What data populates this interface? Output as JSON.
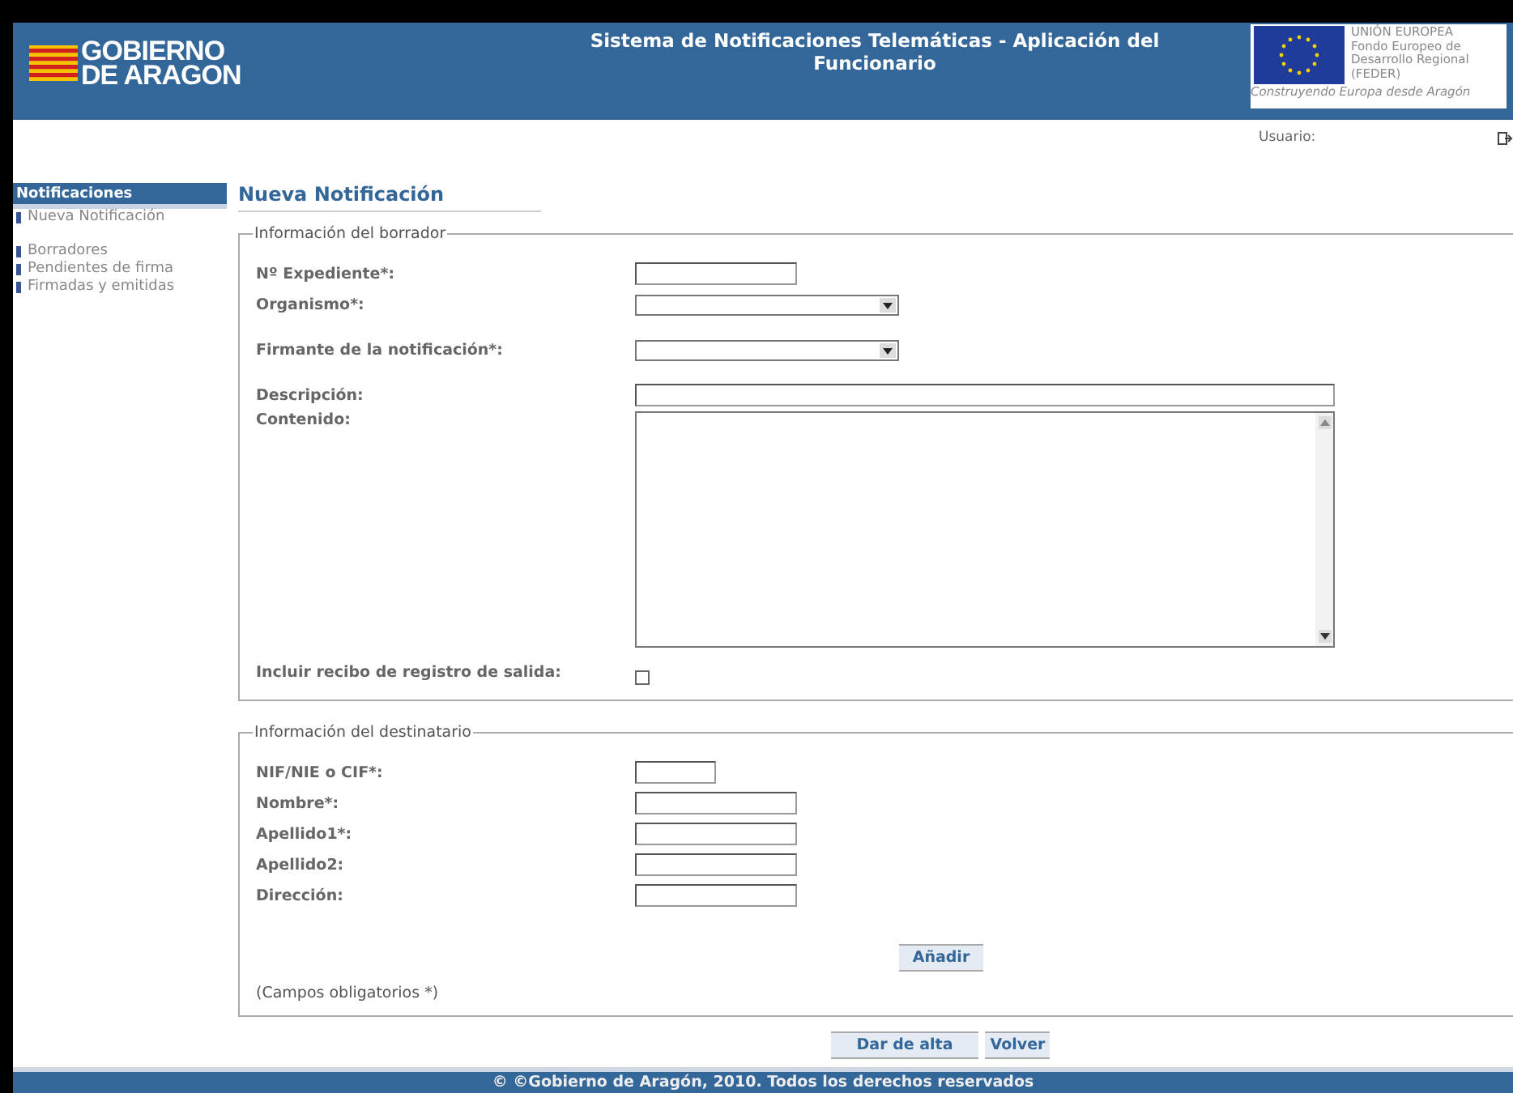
{
  "header": {
    "logo_text": [
      "GOBIERNO",
      "DE ARAGON"
    ],
    "title": "Sistema de Notificaciones Telemáticas - Aplicación del Funcionario",
    "eu_lines": [
      "UNIÓN EUROPEA",
      "Fondo Europeo de",
      "Desarrollo Regional",
      "(FEDER)"
    ],
    "eu_caption": "Construyendo Europa desde Aragón"
  },
  "user_label": "Usuario:",
  "sidebar": {
    "header": "Notificaciones",
    "groups": [
      [
        "Nueva Notificación"
      ],
      [
        "Borradores",
        "Pendientes de firma",
        "Firmadas y emitidas"
      ]
    ]
  },
  "page_title": "Nueva Notificación",
  "sections": [
    {
      "legend": "Información del borrador",
      "fields": [
        {
          "label": "Nº Expediente*:",
          "kind": "text"
        },
        {
          "label": "Organismo*:",
          "kind": "select"
        },
        {
          "label": "Firmante de la notificación*:",
          "kind": "select"
        },
        {
          "label": "Descripción:",
          "kind": "wide"
        },
        {
          "label": "Contenido:",
          "kind": "textarea"
        },
        {
          "label": "Incluir recibo de registro de salida:",
          "kind": "checkbox",
          "checked": false
        }
      ]
    },
    {
      "legend": "Información del destinatario",
      "fields": [
        {
          "label": "NIF/NIE o CIF*:",
          "kind": "short"
        },
        {
          "label": "Nombre*:",
          "kind": "text"
        },
        {
          "label": "Apellido1*:",
          "kind": "text"
        },
        {
          "label": "Apellido2:",
          "kind": "text"
        },
        {
          "label": "Dirección:",
          "kind": "text"
        }
      ],
      "button": "Añadir",
      "note": "(Campos obligatorios *)"
    }
  ],
  "buttons": [
    "Dar de alta",
    "Volver"
  ],
  "footer": "© ©Gobierno de Aragón, 2010. Todos los derechos reservados"
}
